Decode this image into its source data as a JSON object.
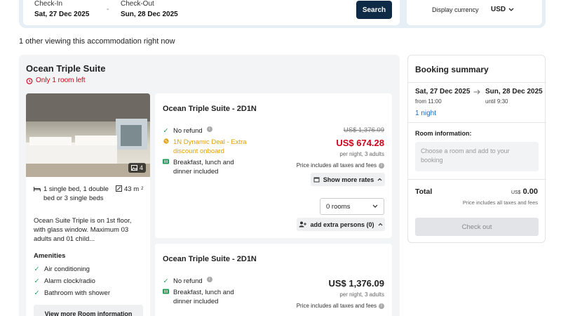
{
  "search": {
    "checkin_label": "Check-In",
    "checkin_value": "Sat, 27 Dec 2025",
    "separator": "-",
    "checkout_label": "Check-Out",
    "checkout_value": "Sun, 28 Dec 2025",
    "search_button": "Search",
    "currency_label": "Display currency",
    "currency_value": "USD"
  },
  "viewing_text": "1 other viewing this accommodation right now",
  "room": {
    "title": "Ocean Triple Suite",
    "rooms_left": "Only 1 room left",
    "photo_count": "4",
    "beds": "1 single bed, 1 double bed or 3 single beds",
    "size": "43 m",
    "size_sup": "2",
    "description": "Ocean Suite Triple is on 1st floor, with glass window. Maximum 03 adults and 01 child...",
    "amenities_title": "Amenities",
    "amenities": [
      "Air conditioning",
      "Alarm clock/radio",
      "Bathroom with shower"
    ],
    "more_button": "View more Room information"
  },
  "rates": [
    {
      "title": "Ocean Triple Suite - 2D1N",
      "no_refund": "No refund",
      "deal": "1N Dynamic Deal - Extra discount onboard",
      "meals": "Breakfast, lunch and dinner included",
      "old_price": "US$ 1,376.09",
      "price": "US$ 674.28",
      "per_night": "per night, 3 adults",
      "taxes": "Price includes all taxes and fees",
      "show_more": "Show more rates",
      "rooms_select": "0 rooms",
      "extra_persons": "add extra persons (0)"
    },
    {
      "title": "Ocean Triple Suite - 2D1N",
      "no_refund": "No refund",
      "meals": "Breakfast, lunch and dinner included",
      "price": "US$ 1,376.09",
      "per_night": "per night, 3 adults",
      "taxes": "Price includes all taxes and fees"
    }
  ],
  "summary": {
    "title": "Booking summary",
    "checkin_date": "Sat, 27 Dec 2025",
    "checkin_time": "from 11:00",
    "checkout_date": "Sun, 28 Dec 2025",
    "checkout_time": "until 9:30",
    "nights": "1 night",
    "room_info_label": "Room information:",
    "room_placeholder": "Choose a room and add to your booking",
    "total_label": "Total",
    "total_currency": "US$",
    "total_value": "0.00",
    "taxes": "Price includes all taxes and fees",
    "checkout_button": "Check out"
  },
  "colors": {
    "accent_navy": "#0e2a47",
    "alert_red": "#d0021b",
    "deal_orange": "#e0a000",
    "check_green": "#1f9d55",
    "link_blue": "#1a6fc0"
  }
}
